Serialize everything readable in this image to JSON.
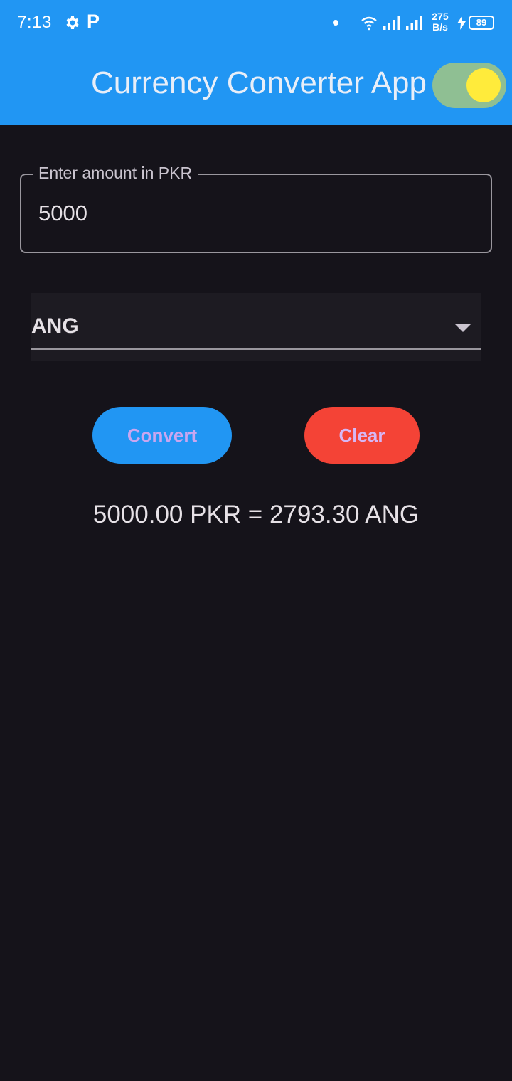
{
  "status_bar": {
    "time": "7:13",
    "net_speed_value": "275",
    "net_speed_unit": "B/s",
    "battery": "89",
    "icons": [
      "gear-icon",
      "p-app-icon",
      "dot-icon",
      "wifi-icon",
      "signal-icon",
      "signal-icon",
      "bolt-icon",
      "battery-icon"
    ]
  },
  "app_bar": {
    "title": "Currency Converter App",
    "theme_toggle_on": true,
    "color": "#2196f3"
  },
  "amount_field": {
    "label": "Enter amount in PKR",
    "value": "5000"
  },
  "currency_dropdown": {
    "selected": "ANG"
  },
  "buttons": {
    "convert_label": "Convert",
    "clear_label": "Clear",
    "convert_color": "#2196f3",
    "clear_color": "#f44336"
  },
  "result": {
    "text": "5000.00 PKR = 2793.30 ANG"
  }
}
